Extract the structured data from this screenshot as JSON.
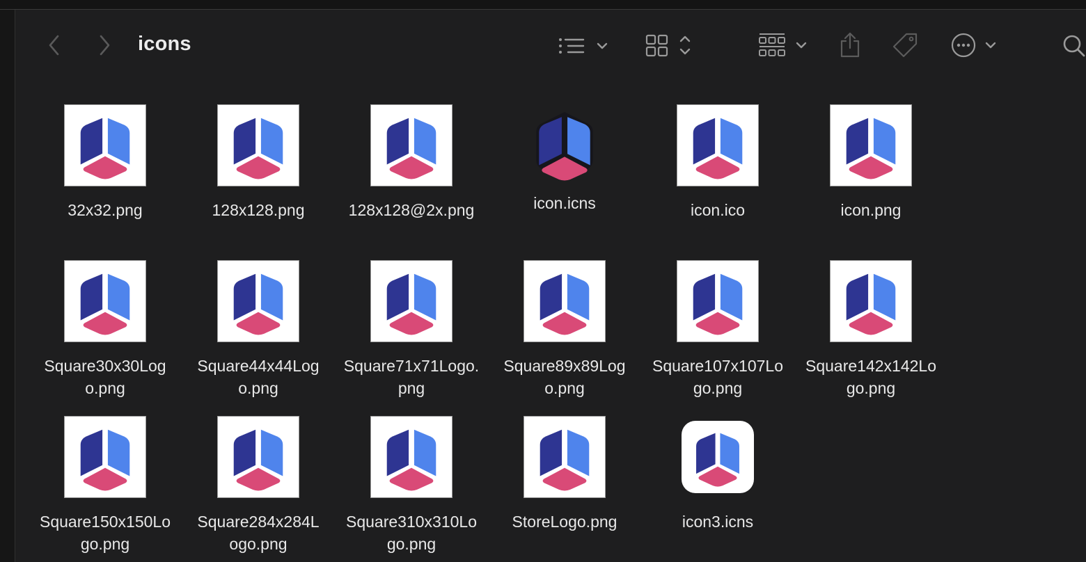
{
  "window": {
    "title": "icons"
  },
  "toolbar": {
    "back": "back-icon",
    "forward": "forward-icon",
    "view_list": "list-view-icon",
    "view_grid": "grid-view-icon",
    "group": "group-icon",
    "share": "share-icon",
    "tag": "tag-icon",
    "more": "more-icon",
    "search": "search-icon"
  },
  "colors": {
    "dark_blue": "#2e3592",
    "light_blue": "#4f84ec",
    "pink": "#d94a77",
    "background": "#1e1e1f"
  },
  "files": [
    {
      "name": "32x32.png",
      "label": "32x32.png",
      "style": "framed"
    },
    {
      "name": "128x128.png",
      "label": "128x128.png",
      "style": "framed"
    },
    {
      "name": "128x128@2x.png",
      "label": "128x128@2x.png",
      "style": "framed"
    },
    {
      "name": "icon.icns",
      "label": "icon.icns",
      "style": "plain"
    },
    {
      "name": "icon.ico",
      "label": "icon.ico",
      "style": "framed"
    },
    {
      "name": "icon.png",
      "label": "icon.png",
      "style": "framed"
    },
    {
      "name": "Square30x30Logo.png",
      "label": "Square30x30Log\no.png",
      "style": "framed"
    },
    {
      "name": "Square44x44Logo.png",
      "label": "Square44x44Log\no.png",
      "style": "framed"
    },
    {
      "name": "Square71x71Logo.png",
      "label": "Square71x71Logo.\npng",
      "style": "framed"
    },
    {
      "name": "Square89x89Logo.png",
      "label": "Square89x89Log\no.png",
      "style": "framed"
    },
    {
      "name": "Square107x107Logo.png",
      "label": "Square107x107Lo\ngo.png",
      "style": "framed"
    },
    {
      "name": "Square142x142Logo.png",
      "label": "Square142x142Lo\ngo.png",
      "style": "framed"
    },
    {
      "name": "Square150x150Logo.png",
      "label": "Square150x150Lo\ngo.png",
      "style": "framed"
    },
    {
      "name": "Square284x284Logo.png",
      "label": "Square284x284L\nogo.png",
      "style": "framed"
    },
    {
      "name": "Square310x310Logo.png",
      "label": "Square310x310Lo\ngo.png",
      "style": "framed"
    },
    {
      "name": "StoreLogo.png",
      "label": "StoreLogo.png",
      "style": "framed"
    },
    {
      "name": "icon3.icns",
      "label": "icon3.icns",
      "style": "rounded"
    }
  ]
}
